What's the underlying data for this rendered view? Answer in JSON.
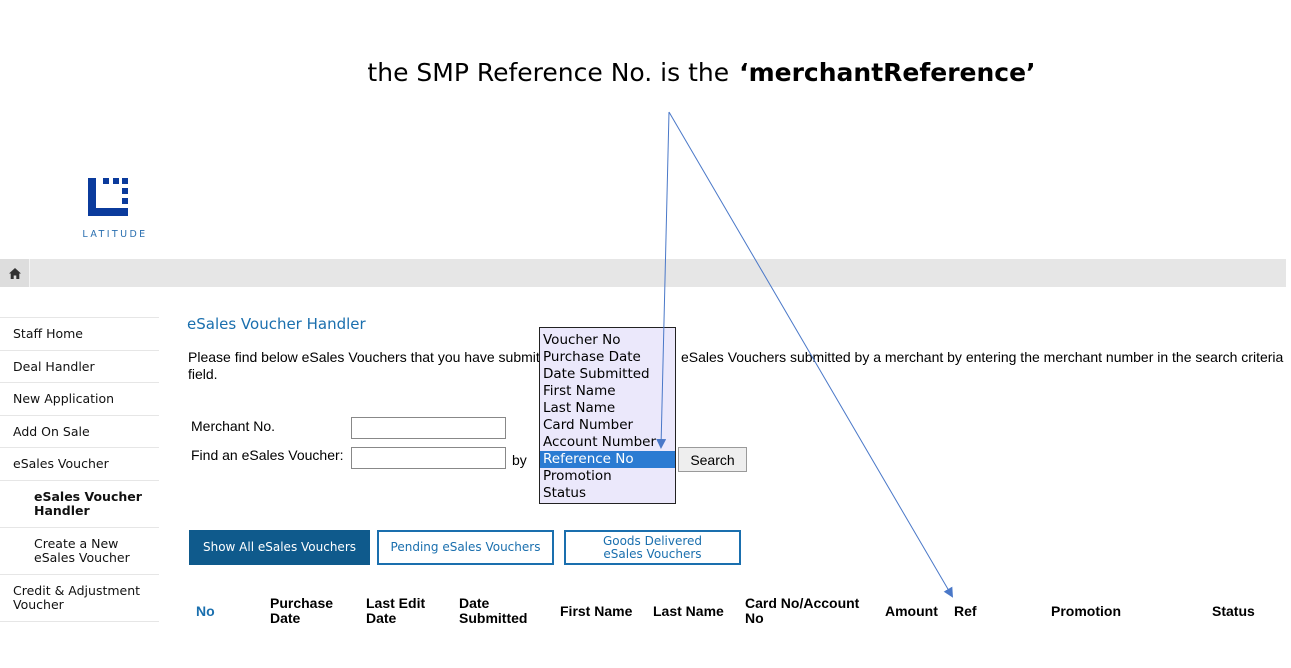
{
  "annotation": {
    "prefix": "the SMP Reference No. is the",
    "highlight": "‘merchantReference’"
  },
  "logo": {
    "text": "LATITUDE"
  },
  "navbar": {
    "home_icon": "home-icon"
  },
  "sidebar": {
    "items": [
      {
        "label": "Staff Home"
      },
      {
        "label": "Deal Handler"
      },
      {
        "label": "New Application"
      },
      {
        "label": "Add On Sale"
      },
      {
        "label": "eSales Voucher"
      },
      {
        "label": "eSales Voucher Handler"
      },
      {
        "label": "Create a New eSales Voucher"
      },
      {
        "label": "Credit & Adjustment Voucher"
      }
    ]
  },
  "main": {
    "heading": "eSales Voucher Handler",
    "desc_a": "Please find below eSales Vouchers that you have submit",
    "desc_b": "eSales Vouchers submitted by a merchant by entering the merchant number in the search criteria",
    "desc_c": "field.",
    "merchant_label": "Merchant No.",
    "merchant_value": "",
    "find_label": "Find an eSales Voucher:",
    "find_value": "",
    "by_label": "by",
    "search_label": "Search"
  },
  "dropdown": {
    "options": [
      "Voucher No",
      "Purchase Date",
      "Date Submitted",
      "First Name",
      "Last Name",
      "Card Number",
      "Account Number",
      "Reference No",
      "Promotion",
      "Status"
    ],
    "selected": "Reference No"
  },
  "tabs": {
    "all": "Show All eSales Vouchers",
    "pending": "Pending eSales Vouchers",
    "delivered": "Goods Delivered eSales Vouchers"
  },
  "table": {
    "headers": [
      "No",
      "Purchase Date",
      "Last Edit Date",
      "Date Submitted",
      "First Name",
      "Last Name",
      "Card No/Account No",
      "Amount",
      "Ref",
      "Promotion",
      "Status"
    ]
  },
  "colors": {
    "accent": "#1a6fae",
    "primary_button": "#0f5a8c",
    "selection": "#2b7bd2",
    "arrow": "#4a78c8"
  }
}
